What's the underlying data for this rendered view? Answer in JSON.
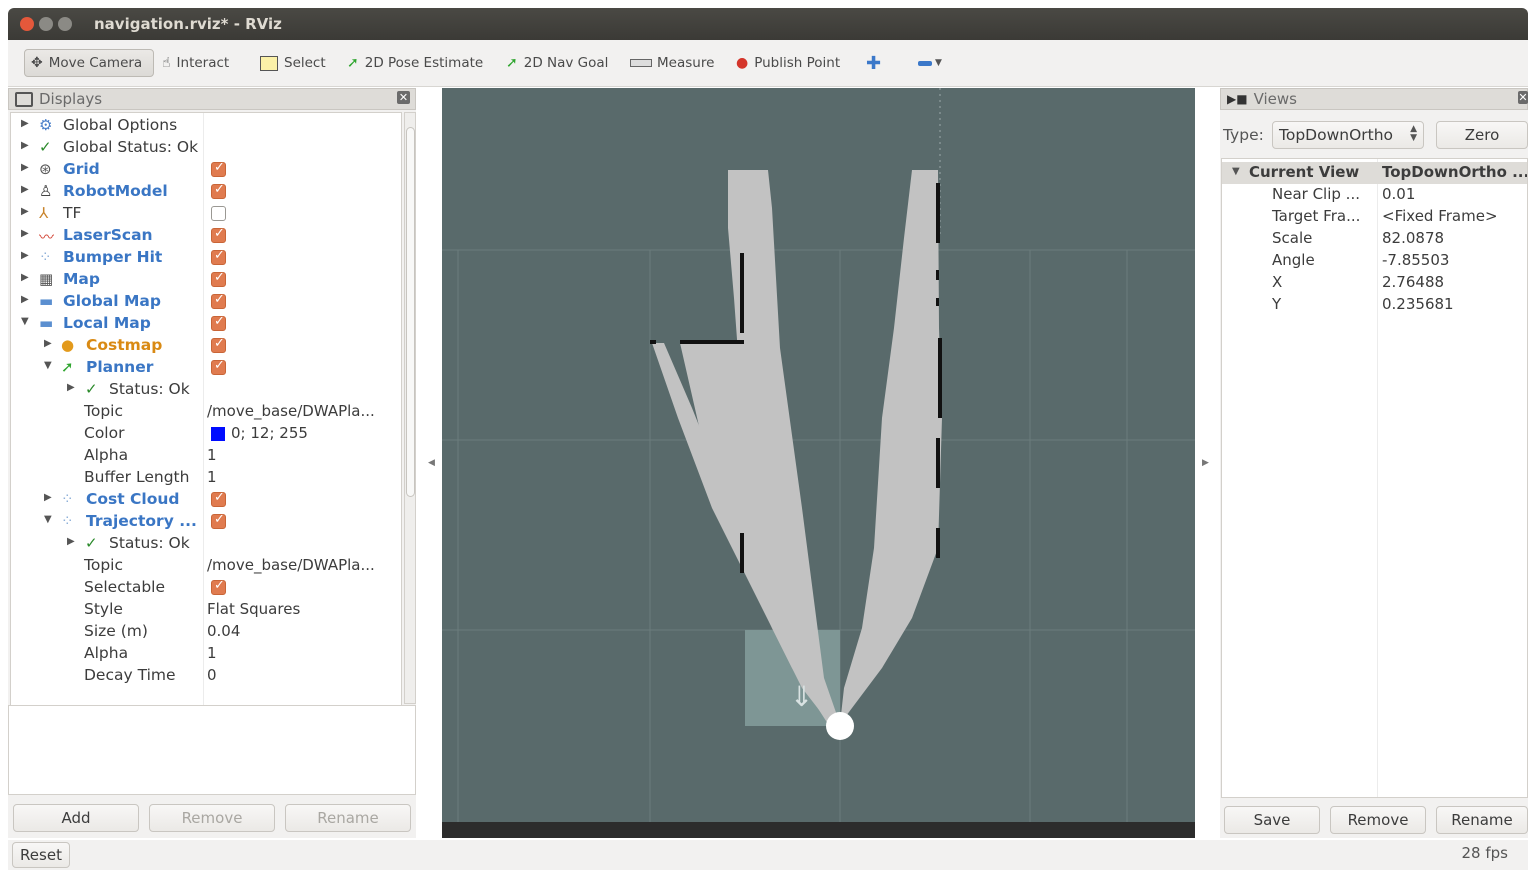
{
  "window": {
    "title": "navigation.rviz* - RViz"
  },
  "toolbar": {
    "tools": [
      {
        "label": "Move Camera",
        "icon": "move-camera-icon"
      },
      {
        "label": "Interact",
        "icon": "interact-hand-icon"
      },
      {
        "label": "Select",
        "icon": "select-box-icon"
      },
      {
        "label": "2D Pose Estimate",
        "icon": "pose-arrow-icon"
      },
      {
        "label": "2D Nav Goal",
        "icon": "nav-goal-arrow-icon"
      },
      {
        "label": "Measure",
        "icon": "ruler-icon"
      },
      {
        "label": "Publish Point",
        "icon": "map-pin-icon"
      }
    ],
    "add_tool_icon": "plus-icon",
    "remove_tool_icon": "minus-icon"
  },
  "displays": {
    "header": "Displays",
    "items": [
      {
        "label": "Global Options"
      },
      {
        "label": "Global Status: Ok"
      },
      {
        "label": "Grid"
      },
      {
        "label": "RobotModel"
      },
      {
        "label": "TF"
      },
      {
        "label": "LaserScan"
      },
      {
        "label": "Bumper Hit"
      },
      {
        "label": "Map"
      },
      {
        "label": "Global Map"
      },
      {
        "label": "Local Map"
      },
      {
        "label": "Costmap"
      },
      {
        "label": "Planner"
      },
      {
        "label": "Status: Ok"
      },
      {
        "label": "Topic",
        "value": "/move_base/DWAPla..."
      },
      {
        "label": "Color",
        "value": "0; 12; 255"
      },
      {
        "label": "Alpha",
        "value": "1"
      },
      {
        "label": "Buffer Length",
        "value": "1"
      },
      {
        "label": "Cost Cloud"
      },
      {
        "label": "Trajectory ..."
      },
      {
        "label": "Status: Ok"
      },
      {
        "label": "Topic",
        "value": "/move_base/DWAPla..."
      },
      {
        "label": "Selectable"
      },
      {
        "label": "Style",
        "value": "Flat Squares"
      },
      {
        "label": "Size (m)",
        "value": "0.04"
      },
      {
        "label": "Alpha",
        "value": "1"
      },
      {
        "label": "Decay Time",
        "value": "0"
      }
    ],
    "checkboxes": {
      "grid": true,
      "robotmodel": true,
      "tf": false,
      "laserscan": true,
      "bumper_hit": true,
      "map": true,
      "global_map": true,
      "local_map": true,
      "costmap": true,
      "planner": true,
      "cost_cloud": true,
      "trajectory": true,
      "selectable": true
    },
    "planner_color": "#000cff",
    "buttons": {
      "add": "Add",
      "remove": "Remove",
      "rename": "Rename"
    }
  },
  "views": {
    "header": "Views",
    "type_label": "Type:",
    "type_value": "TopDownOrtho",
    "zero_label": "Zero",
    "current_view_label": "Current View",
    "current_view_value": "TopDownOrtho ...",
    "props": [
      {
        "key": "Near Clip ...",
        "value": "0.01"
      },
      {
        "key": "Target Fra...",
        "value": "<Fixed Frame>"
      },
      {
        "key": "Scale",
        "value": "82.0878"
      },
      {
        "key": "Angle",
        "value": "-7.85503"
      },
      {
        "key": "X",
        "value": "2.76488"
      },
      {
        "key": "Y",
        "value": "0.235681"
      }
    ],
    "buttons": {
      "save": "Save",
      "remove": "Remove",
      "rename": "Rename"
    }
  },
  "status": {
    "reset_label": "Reset",
    "fps": "28 fps"
  },
  "colors": {
    "viewport_bg": "#596a6b",
    "scan_fill": "#c2c2c2",
    "accent_checkbox": "#e07b4f",
    "link_blue": "#3a76c4",
    "costmap_orange": "#d98a14"
  }
}
